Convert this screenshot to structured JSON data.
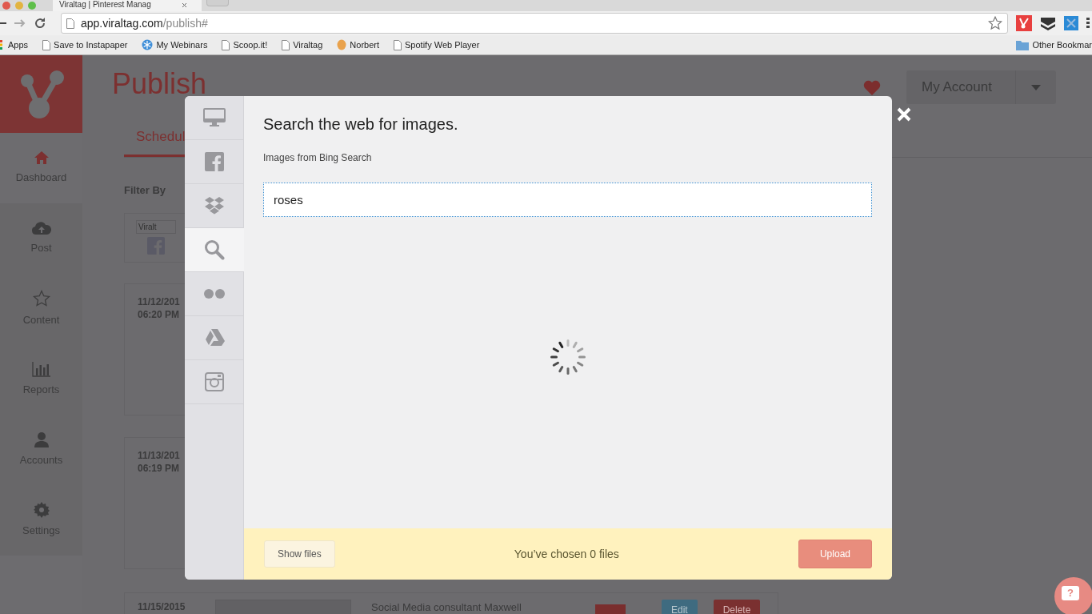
{
  "browser": {
    "tab_title": "Viraltag | Pinterest Manag",
    "url_host": "app.viraltag.com",
    "url_path": "/publish#",
    "bookmarks": [
      {
        "kind": "apps",
        "label": "Apps"
      },
      {
        "kind": "page",
        "label": "Save to Instapaper"
      },
      {
        "kind": "webinar",
        "label": "My Webinars"
      },
      {
        "kind": "page",
        "label": "Scoop.it!"
      },
      {
        "kind": "page",
        "label": "Viraltag"
      },
      {
        "kind": "person",
        "label": "Norbert"
      },
      {
        "kind": "page",
        "label": "Spotify Web Player"
      }
    ],
    "other_bookmarks": "Other Bookmar"
  },
  "sidebar": {
    "items": [
      {
        "kind": "home",
        "label": "Dashboard",
        "selected": true
      },
      {
        "kind": "cloud",
        "label": "Post",
        "selected": false
      },
      {
        "kind": "star",
        "label": "Content",
        "selected": false
      },
      {
        "kind": "chart",
        "label": "Reports",
        "selected": false
      },
      {
        "kind": "user",
        "label": "Accounts",
        "selected": false
      },
      {
        "kind": "gear",
        "label": "Settings",
        "selected": false
      }
    ]
  },
  "header": {
    "title": "Publish",
    "account_button": "My Account"
  },
  "tabs": [
    {
      "label": "Schedul",
      "selected": true
    }
  ],
  "filter_label": "Filter By",
  "account_filter": {
    "image_alt": "Viralt"
  },
  "posts": [
    {
      "date": "11/12/201",
      "time": "06:20 PM"
    },
    {
      "date": "11/13/201",
      "time": "06:19 PM"
    },
    {
      "date": "11/15/2015",
      "text": "Social Media consultant Maxwell",
      "buttons": [
        {
          "kind": "edit",
          "label": "Edit"
        },
        {
          "kind": "delete",
          "label": "Delete"
        }
      ]
    }
  ],
  "modal": {
    "title": "Search the web for images.",
    "source_label": "Images from Bing Search",
    "search_value": "roses",
    "sources": [
      {
        "kind": "computer",
        "selected": false
      },
      {
        "kind": "facebook",
        "selected": false
      },
      {
        "kind": "dropbox",
        "selected": false
      },
      {
        "kind": "search",
        "selected": true
      },
      {
        "kind": "flickr",
        "selected": false
      },
      {
        "kind": "drive",
        "selected": false
      },
      {
        "kind": "instagram",
        "selected": false
      }
    ],
    "show_files_button": "Show files",
    "chosen_text": "You’ve chosen 0 files",
    "upload_button": "Upload"
  },
  "help_button": "?"
}
